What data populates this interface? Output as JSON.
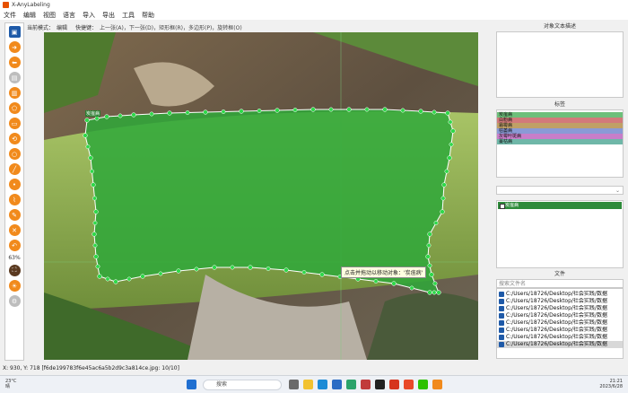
{
  "window": {
    "title": "X-AnyLabeling"
  },
  "menu": [
    "文件",
    "编辑",
    "视图",
    "语言",
    "导入",
    "导出",
    "工具",
    "帮助"
  ],
  "mode_bar": {
    "mode_label": "当前模式：",
    "mode_value": "编辑",
    "shortcut_label": "快捷键：",
    "shortcuts": "上一张(A)，下一张(D)，矩形框(R)，多边形(P)，旋转框(O)"
  },
  "toolbar": {
    "zoom": "63%",
    "tools": [
      {
        "icon": "open-icon",
        "color": "#1e5aa8"
      },
      {
        "icon": "next-icon",
        "color": "#f18a1c"
      },
      {
        "icon": "prev-icon",
        "color": "#f18a1c"
      },
      {
        "icon": "save-icon",
        "color": "#bdbdbd"
      },
      {
        "icon": "delete-file-icon",
        "color": "#f18a1c"
      },
      {
        "icon": "polygon-icon",
        "color": "#f18a1c"
      },
      {
        "icon": "rectangle-icon",
        "color": "#f18a1c"
      },
      {
        "icon": "rotate-icon",
        "color": "#f18a1c"
      },
      {
        "icon": "circle-icon",
        "color": "#f18a1c"
      },
      {
        "icon": "line-icon",
        "color": "#f18a1c"
      },
      {
        "icon": "point-icon",
        "color": "#f18a1c"
      },
      {
        "icon": "linestrip-icon",
        "color": "#f18a1c"
      },
      {
        "icon": "edit-icon",
        "color": "#f18a1c"
      },
      {
        "icon": "cancel-icon",
        "color": "#f18a1c"
      },
      {
        "icon": "undo-icon",
        "color": "#f18a1c"
      },
      {
        "icon": "fit-window-icon",
        "color": "#5b3a20"
      },
      {
        "icon": "brightness-icon",
        "color": "#f18a1c"
      },
      {
        "icon": "settings-icon",
        "color": "#bdbdbd"
      }
    ]
  },
  "canvas": {
    "shape_tag": "炭疽病",
    "tooltip": "点击并拖动以移动对象：'炭疽病'",
    "shape_color": "#2fa83a"
  },
  "right": {
    "description_title": "对象文本描述",
    "labels_title": "标签",
    "labels": [
      {
        "name": "炭疽病",
        "color": "#6dbf7a"
      },
      {
        "name": "白粉病",
        "color": "#d27a7a"
      },
      {
        "name": "霜霉病",
        "color": "#c0a066"
      },
      {
        "name": "枯萎病",
        "color": "#8a9ad6"
      },
      {
        "name": "灰霉叶斑病",
        "color": "#c77ec9"
      },
      {
        "name": "蔓枯病",
        "color": "#6fb7a8"
      }
    ],
    "object_list": [
      {
        "name": "炭疽病"
      }
    ],
    "files_title": "文件",
    "search_placeholder": "搜索文件名",
    "files": [
      "C:/Users/18726/Desktop/社会实践/数据",
      "C:/Users/18726/Desktop/社会实践/数据",
      "C:/Users/18726/Desktop/社会实践/数据",
      "C:/Users/18726/Desktop/社会实践/数据",
      "C:/Users/18726/Desktop/社会实践/数据",
      "C:/Users/18726/Desktop/社会实践/数据",
      "C:/Users/18726/Desktop/社会实践/数据",
      "C:/Users/18726/Desktop/社会实践/数据"
    ],
    "current_file_index": 7
  },
  "status": "X: 930, Y: 718 [f6de199783f6e45ac6a5b2d9c3a814ce.jpg: 10/10]",
  "taskbar": {
    "weather_temp": "23°C",
    "weather_desc": "晴",
    "search": "搜索",
    "time": "21:21",
    "date": "2023/6/28"
  }
}
